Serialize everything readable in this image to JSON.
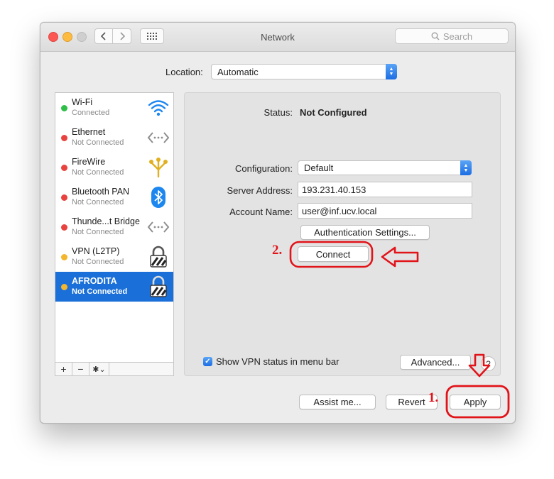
{
  "window": {
    "title": "Network"
  },
  "search": {
    "placeholder": "Search"
  },
  "location": {
    "label": "Location:",
    "value": "Automatic"
  },
  "services": [
    {
      "name": "Wi-Fi",
      "status": "Connected",
      "dot_color": "#2fbf48",
      "icon": "wifi-icon",
      "selected": false
    },
    {
      "name": "Ethernet",
      "status": "Not Connected",
      "dot_color": "#e8433f",
      "icon": "ethernet-icon",
      "selected": false
    },
    {
      "name": "FireWire",
      "status": "Not Connected",
      "dot_color": "#e8433f",
      "icon": "firewire-icon",
      "selected": false
    },
    {
      "name": "Bluetooth PAN",
      "status": "Not Connected",
      "dot_color": "#e8433f",
      "icon": "bluetooth-icon",
      "selected": false
    },
    {
      "name": "Thunde...t Bridge",
      "status": "Not Connected",
      "dot_color": "#e8433f",
      "icon": "thunderbolt-bridge-icon",
      "selected": false
    },
    {
      "name": "VPN (L2TP)",
      "status": "Not Connected",
      "dot_color": "#f3b62f",
      "icon": "vpn-lock-icon",
      "selected": false
    },
    {
      "name": "AFRODITA",
      "status": "Not Connected",
      "dot_color": "#f3b62f",
      "icon": "vpn-lock-icon",
      "selected": true
    }
  ],
  "sidebar_tools": {
    "add": "+",
    "remove": "−",
    "gear": "✱⌄"
  },
  "detail": {
    "status_label": "Status:",
    "status_value": "Not Configured",
    "configuration_label": "Configuration:",
    "configuration_value": "Default",
    "server_label": "Server Address:",
    "server_value": "193.231.40.153",
    "account_label": "Account Name:",
    "account_value": "user@inf.ucv.local",
    "auth_button": "Authentication Settings...",
    "connect_button": "Connect",
    "show_vpn_label": "Show VPN status in menu bar",
    "show_vpn_checked": true,
    "advanced_button": "Advanced...",
    "help_label": "?"
  },
  "footer": {
    "assist_button": "Assist me...",
    "revert_button": "Revert",
    "apply_button": "Apply"
  },
  "annotations": {
    "step1": "1.",
    "step2": "2.",
    "highlight_color": "#e1141a"
  }
}
